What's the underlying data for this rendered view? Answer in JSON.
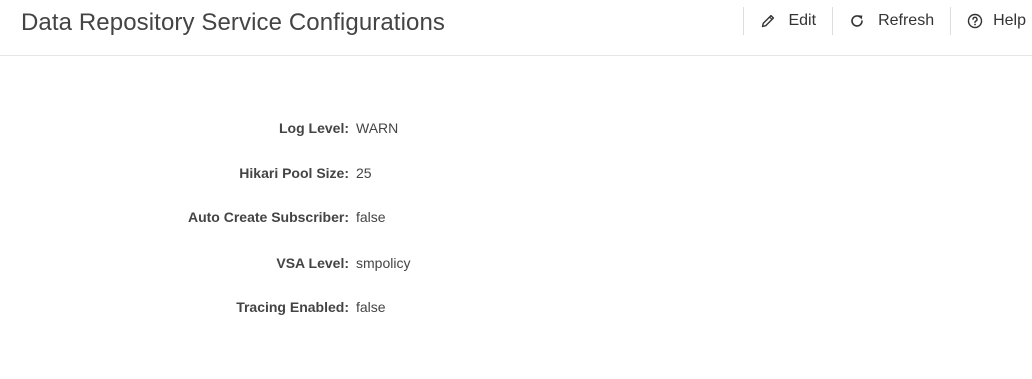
{
  "header": {
    "title": "Data Repository Service Configurations"
  },
  "toolbar": {
    "edit_label": "Edit",
    "refresh_label": "Refresh",
    "help_label": "Help",
    "edit_icon": "pencil-icon",
    "refresh_icon": "refresh-icon",
    "help_icon": "help-circle-icon"
  },
  "config": {
    "items": [
      {
        "label": "Log Level:",
        "value": "WARN"
      },
      {
        "label": "Hikari Pool Size:",
        "value": "25"
      },
      {
        "label": "Auto Create Subscriber:",
        "value": "false"
      },
      {
        "label": "VSA Level:",
        "value": "smpolicy"
      },
      {
        "label": "Tracing Enabled:",
        "value": "false"
      }
    ]
  }
}
